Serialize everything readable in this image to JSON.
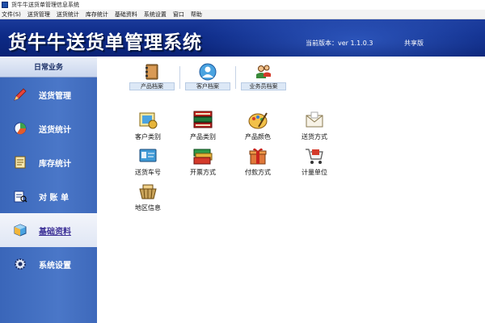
{
  "window": {
    "title": "货牛牛送货单管理信息系统"
  },
  "menu": {
    "items": [
      "文件(S)",
      "送货管理",
      "送货统计",
      "库存统计",
      "基础资料",
      "系统设置",
      "窗口",
      "帮助"
    ]
  },
  "banner": {
    "title": "货牛牛送货单管理系统",
    "version": "当前版本：ver 1.1.0.3",
    "edition": "共享版"
  },
  "sidebar": {
    "header": "日常业务",
    "items": [
      {
        "label": "送货管理",
        "icon": "pencil-icon"
      },
      {
        "label": "送货统计",
        "icon": "stats-icon"
      },
      {
        "label": "库存统计",
        "icon": "inventory-icon"
      },
      {
        "label": "对 账 单",
        "icon": "statement-icon"
      },
      {
        "label": "基础资料",
        "icon": "cube-icon",
        "active": true
      },
      {
        "label": "系统设置",
        "icon": "gear-icon"
      }
    ]
  },
  "tabs": [
    {
      "label": "产品档案",
      "icon": "book-icon"
    },
    {
      "label": "客户档案",
      "icon": "user-icon"
    },
    {
      "label": "业务员档案",
      "icon": "staff-icon"
    }
  ],
  "tiles": [
    {
      "label": "客户类别",
      "icon": "customer-category-icon"
    },
    {
      "label": "产品类别",
      "icon": "books-stack-icon"
    },
    {
      "label": "产品颜色",
      "icon": "palette-icon"
    },
    {
      "label": "送货方式",
      "icon": "envelope-icon"
    },
    {
      "label": "送货车号",
      "icon": "id-card-icon"
    },
    {
      "label": "开票方式",
      "icon": "cards-icon"
    },
    {
      "label": "付款方式",
      "icon": "gift-box-icon"
    },
    {
      "label": "计量单位",
      "icon": "cart-icon"
    },
    {
      "label": "地区信息",
      "icon": "basket-icon"
    }
  ],
  "colors": {
    "banner": "#0d2a86",
    "sidebar": "#4a77c8",
    "active_item_text": "#3b2f96"
  }
}
